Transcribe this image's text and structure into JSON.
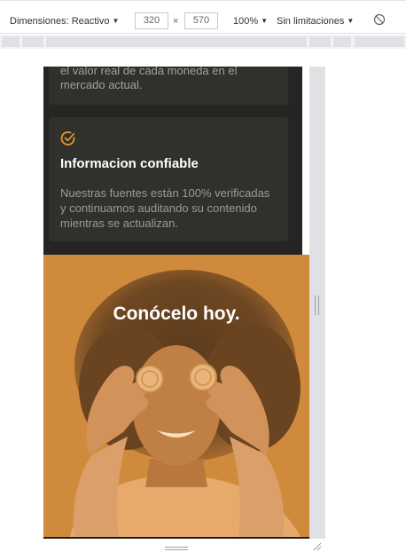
{
  "toolbar": {
    "dimensions_label": "Dimensiones: Reactivo",
    "width_value": "320",
    "height_value": "570",
    "times_symbol": "×",
    "zoom_label": "100%",
    "throttle_label": "Sin limitaciones",
    "caret": "▼"
  },
  "page": {
    "top_card_text": "el valor real de cada moneda en el mercado actual.",
    "feature_card": {
      "icon": "check-circle-icon",
      "title": "Informacion confiable",
      "description": "Nuestras fuentes están 100% verificadas y continuamos auditando su contenido mientras se actualizan."
    },
    "hero": {
      "title": "Conócelo hoy.",
      "image": "woman-holding-coins-over-eyes"
    }
  },
  "colors": {
    "page_bg": "#262523",
    "card_bg": "#30302d",
    "accent": "#e8952f",
    "hero_bg": "#cf8a3c"
  }
}
